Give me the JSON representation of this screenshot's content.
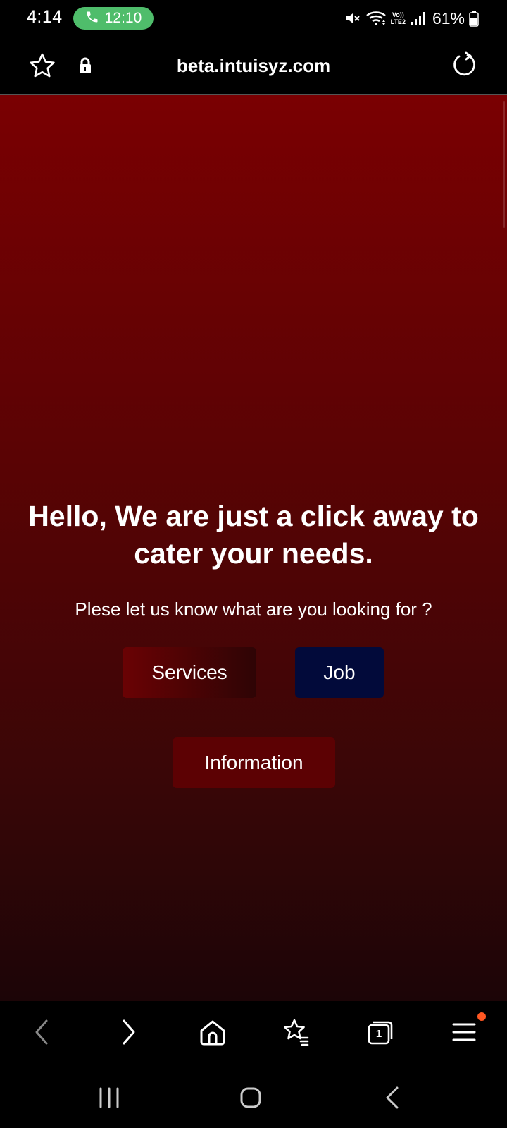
{
  "status_bar": {
    "time": "4:14",
    "call_duration": "12:10",
    "network_label_top": "Vo))",
    "network_label_bottom": "LTE2",
    "battery_percent": "61%",
    "icons": [
      "phone-icon",
      "mute-icon",
      "wifi-icon",
      "signal-icon",
      "battery-icon"
    ]
  },
  "browser": {
    "url": "beta.intuisyz.com",
    "icons": [
      "star-icon",
      "lock-icon",
      "reload-icon"
    ]
  },
  "page": {
    "headline": "Hello, We are just a click away to cater your needs.",
    "subline": "Plese let us know what are you looking for ?",
    "buttons": {
      "services": "Services",
      "job": "Job",
      "information": "Information"
    },
    "colors": {
      "gradient_top": "#7a0002",
      "gradient_bottom": "#1c0507",
      "job_button": "#020a3a",
      "information_button": "#5c0103"
    }
  },
  "browser_nav": {
    "tab_count": "1",
    "icons": [
      "back-icon",
      "forward-icon",
      "home-icon",
      "bookmarks-icon",
      "tabs-icon",
      "menu-icon"
    ],
    "notification_color": "#ff5722"
  },
  "system_nav": {
    "icons": [
      "recents-icon",
      "home-icon",
      "back-icon"
    ]
  }
}
